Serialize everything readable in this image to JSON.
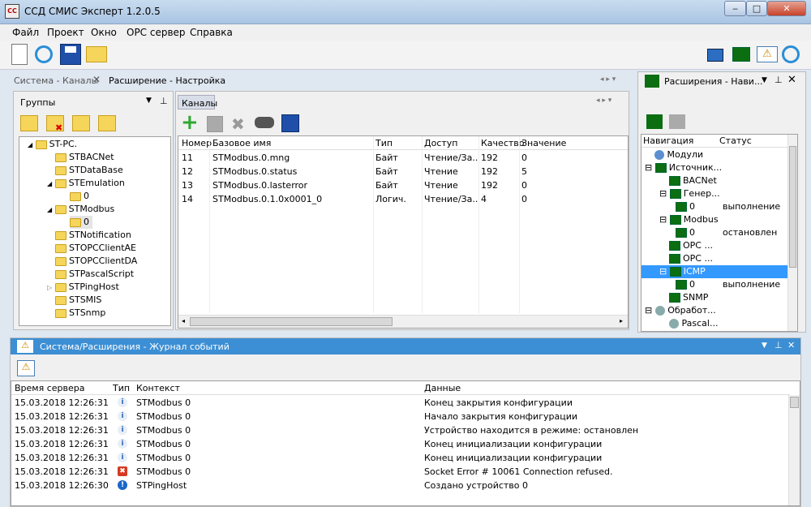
{
  "window": {
    "title": "ССД СМИС Эксперт 1.2.0.5",
    "app_icon_text": "СС"
  },
  "menu": [
    "Файл",
    "Проект",
    "Окно",
    "OPC сервер",
    "Справка"
  ],
  "tabs": {
    "left": "Система - Каналы",
    "active": "Расширение - Настройка",
    "right_panel": "Расширения - Нави..."
  },
  "groups": {
    "title": "Группы",
    "root": "ST-PC.",
    "items": [
      "STBACNet",
      "STDataBase",
      "STEmulation",
      "0",
      "STModbus",
      "0",
      "STNotification",
      "STOPCClientAE",
      "STOPCClientDA",
      "STPascalScript",
      "STPingHost",
      "STSMIS",
      "STSnmp"
    ]
  },
  "channels": {
    "title": "Каналы",
    "columns": [
      "Номер",
      "Базовое имя",
      "Тип",
      "Доступ",
      "Качество",
      "Значение"
    ],
    "rows": [
      [
        "11",
        "STModbus.0.mng",
        "Байт",
        "Чтение/За...",
        "192",
        "0"
      ],
      [
        "12",
        "STModbus.0.status",
        "Байт",
        "Чтение",
        "192",
        "5"
      ],
      [
        "13",
        "STModbus.0.lasterror",
        "Байт",
        "Чтение",
        "192",
        "0"
      ],
      [
        "14",
        "STModbus.0.1.0x0001_0",
        "Логич.",
        "Чтение/За...",
        "4",
        "0"
      ]
    ]
  },
  "navigation": {
    "columns": [
      "Навигация",
      "Статус"
    ],
    "items": [
      {
        "label": "Модули",
        "status": ""
      },
      {
        "label": "Источник...",
        "status": ""
      },
      {
        "label": "BACNet",
        "status": ""
      },
      {
        "label": "Генер...",
        "status": ""
      },
      {
        "label": "0",
        "status": "выполнение"
      },
      {
        "label": "Modbus",
        "status": ""
      },
      {
        "label": "0",
        "status": "остановлен"
      },
      {
        "label": "OPC ...",
        "status": ""
      },
      {
        "label": "OPC ...",
        "status": ""
      },
      {
        "label": "ICMP",
        "status": ""
      },
      {
        "label": "0",
        "status": "выполнение"
      },
      {
        "label": "SNMP",
        "status": ""
      },
      {
        "label": "Обработ...",
        "status": ""
      },
      {
        "label": "Pascal...",
        "status": ""
      }
    ]
  },
  "log": {
    "title": "Система/Расширения - Журнал событий",
    "columns": [
      "Время сервера",
      "Тип",
      "Контекст",
      "Данные"
    ],
    "rows": [
      {
        "time": "15.03.2018 12:26:31",
        "type": "info",
        "context": "STModbus 0",
        "data": "Конец закрытия конфигурации"
      },
      {
        "time": "15.03.2018 12:26:31",
        "type": "info",
        "context": "STModbus 0",
        "data": "Начало закрытия конфигурации"
      },
      {
        "time": "15.03.2018 12:26:31",
        "type": "info",
        "context": "STModbus 0",
        "data": "Устройство находится в режиме: остановлен"
      },
      {
        "time": "15.03.2018 12:26:31",
        "type": "info",
        "context": "STModbus 0",
        "data": "Конец инициализации конфигурации"
      },
      {
        "time": "15.03.2018 12:26:31",
        "type": "info",
        "context": "STModbus 0",
        "data": "Конец инициализации конфигурации"
      },
      {
        "time": "15.03.2018 12:26:31",
        "type": "error",
        "context": "STModbus 0",
        "data": "Socket Error # 10061 Connection refused."
      },
      {
        "time": "15.03.2018 12:26:30",
        "type": "notice",
        "context": "STPingHost",
        "data": "Создано устройство 0"
      }
    ]
  }
}
